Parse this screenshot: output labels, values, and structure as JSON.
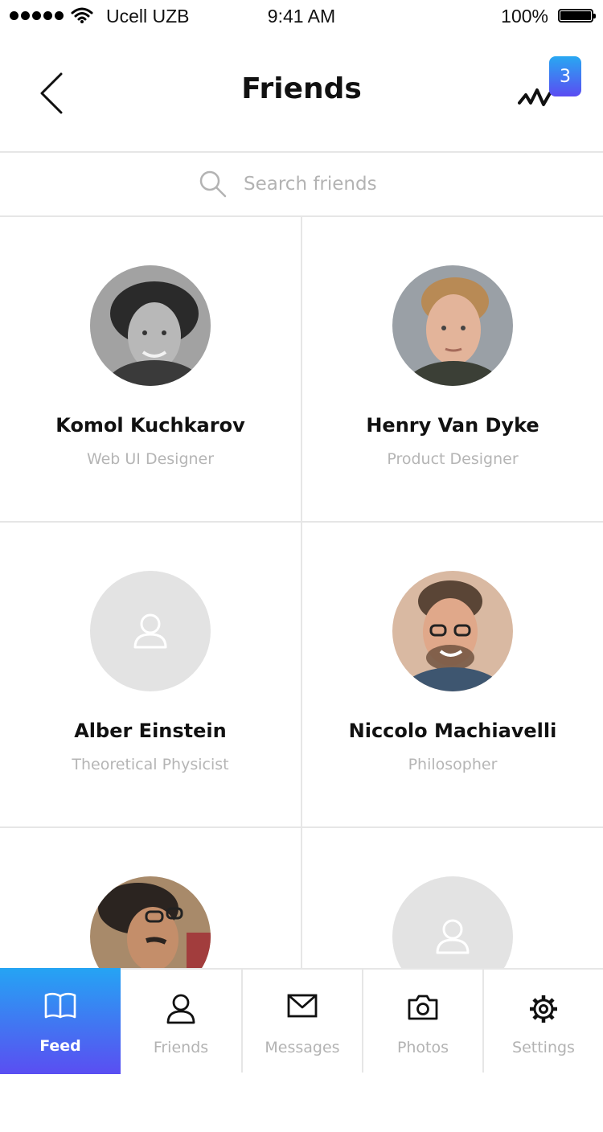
{
  "status_bar": {
    "carrier": "Ucell UZB",
    "time": "9:41 AM",
    "battery": "100%"
  },
  "header": {
    "title": "Friends",
    "notification_count": "3"
  },
  "search": {
    "placeholder": "Search friends"
  },
  "friends": [
    {
      "name": "Komol Kuchkarov",
      "role": "Web UI Designer",
      "avatar": "photo"
    },
    {
      "name": "Henry Van Dyke",
      "role": "Product Designer",
      "avatar": "photo"
    },
    {
      "name": "Alber Einstein",
      "role": "Theoretical Physicist",
      "avatar": "placeholder"
    },
    {
      "name": "Niccolo Machiavelli",
      "role": "Philosopher",
      "avatar": "photo"
    },
    {
      "name": "",
      "role": "",
      "avatar": "photo"
    },
    {
      "name": "",
      "role": "",
      "avatar": "placeholder"
    }
  ],
  "tabs": [
    {
      "label": "Feed",
      "icon": "book-icon",
      "active": true
    },
    {
      "label": "Friends",
      "icon": "user-icon",
      "active": false
    },
    {
      "label": "Messages",
      "icon": "envelope-icon",
      "active": false
    },
    {
      "label": "Photos",
      "icon": "camera-icon",
      "active": false
    },
    {
      "label": "Settings",
      "icon": "gear-icon",
      "active": false
    }
  ],
  "colors": {
    "accent_start": "#25a4f3",
    "accent_end": "#5a4ef2",
    "placeholder_bg": "#e3e3e3",
    "muted_text": "#b5b5b5"
  }
}
